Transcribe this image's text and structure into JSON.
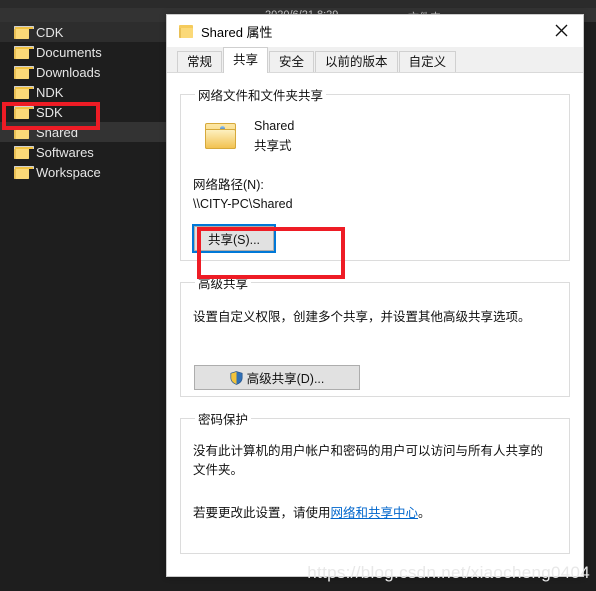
{
  "explorer": {
    "columns": [
      {
        "name": "date",
        "label": "2020/6/21 8:29"
      },
      {
        "name": "type",
        "label": "文件夹"
      }
    ],
    "files": [
      {
        "label": "CDK",
        "state": "hover"
      },
      {
        "label": "Documents",
        "state": "normal"
      },
      {
        "label": "Downloads",
        "state": "normal"
      },
      {
        "label": "NDK",
        "state": "normal"
      },
      {
        "label": "SDK",
        "state": "normal"
      },
      {
        "label": "Shared",
        "state": "selected"
      },
      {
        "label": "Softwares",
        "state": "normal"
      },
      {
        "label": "Workspace",
        "state": "normal"
      }
    ]
  },
  "dialog": {
    "title": "Shared 属性",
    "close_label": "×",
    "tabs": [
      {
        "label": "常规",
        "active": false
      },
      {
        "label": "共享",
        "active": true
      },
      {
        "label": "安全",
        "active": false
      },
      {
        "label": "以前的版本",
        "active": false
      },
      {
        "label": "自定义",
        "active": false
      }
    ],
    "network_group": {
      "legend": "网络文件和文件夹共享",
      "folder_name": "Shared",
      "folder_state": "共享式",
      "path_label": "网络路径(N):",
      "path_value": "\\\\CITY-PC\\Shared",
      "share_button": "共享(S)..."
    },
    "advanced_group": {
      "legend": "高级共享",
      "description": "设置自定义权限，创建多个共享，并设置其他高级共享选项。",
      "button": "高级共享(D)..."
    },
    "password_group": {
      "legend": "密码保护",
      "description": "没有此计算机的用户帐户和密码的用户可以访问与所有人共享的文件夹。",
      "link_prefix": "若要更改此设置，请使用",
      "link_text": "网络和共享中心",
      "link_suffix": "。"
    }
  },
  "annotations": {
    "color": "#ee1c25",
    "sidebar_target": "Shared",
    "button_target": "共享(S)..."
  },
  "watermark": "https://blog.csdn.net/xiaocheng0404"
}
